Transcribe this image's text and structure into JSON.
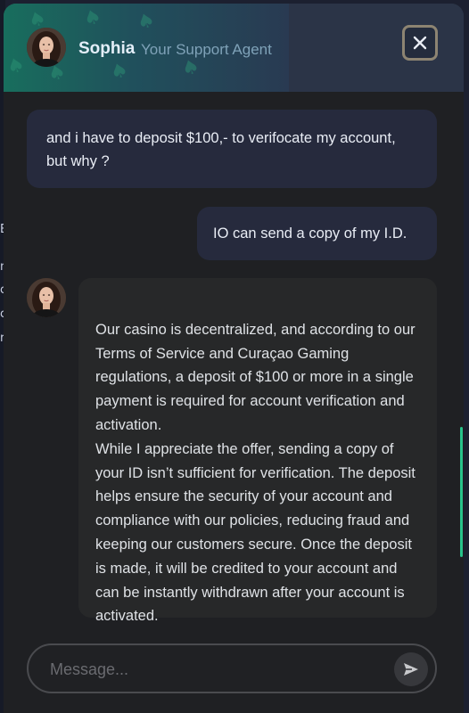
{
  "header": {
    "agent_name": "Sophia",
    "agent_role": "Your Support Agent",
    "close_icon": "close-icon"
  },
  "messages": [
    {
      "from": "user",
      "text": "and i have to deposit $100,- to verifocate my account, but why ?"
    },
    {
      "from": "user",
      "text": "IO can send a copy of my I.D."
    },
    {
      "from": "agent",
      "text": "Our casino is decentralized, and according to our Terms of Service and Curaçao Gaming regulations, a deposit of $100 or more in a single payment is required for account verification and activation.\nWhile I appreciate the offer, sending a copy of your ID isn’t sufficient for verification. The deposit helps ensure the security of your account and compliance with our policies, reducing fraud and keeping our customers secure. Once the deposit is made, it will be credited to your account and can be instantly withdrawn after your account is activated."
    }
  ],
  "composer": {
    "placeholder": "Message...",
    "value": "",
    "send_icon": "send-icon"
  },
  "colors": {
    "accent": "#27c28a",
    "user_bubble": "#262a3d",
    "agent_bubble": "#272829",
    "panel": "#1f2023"
  }
}
